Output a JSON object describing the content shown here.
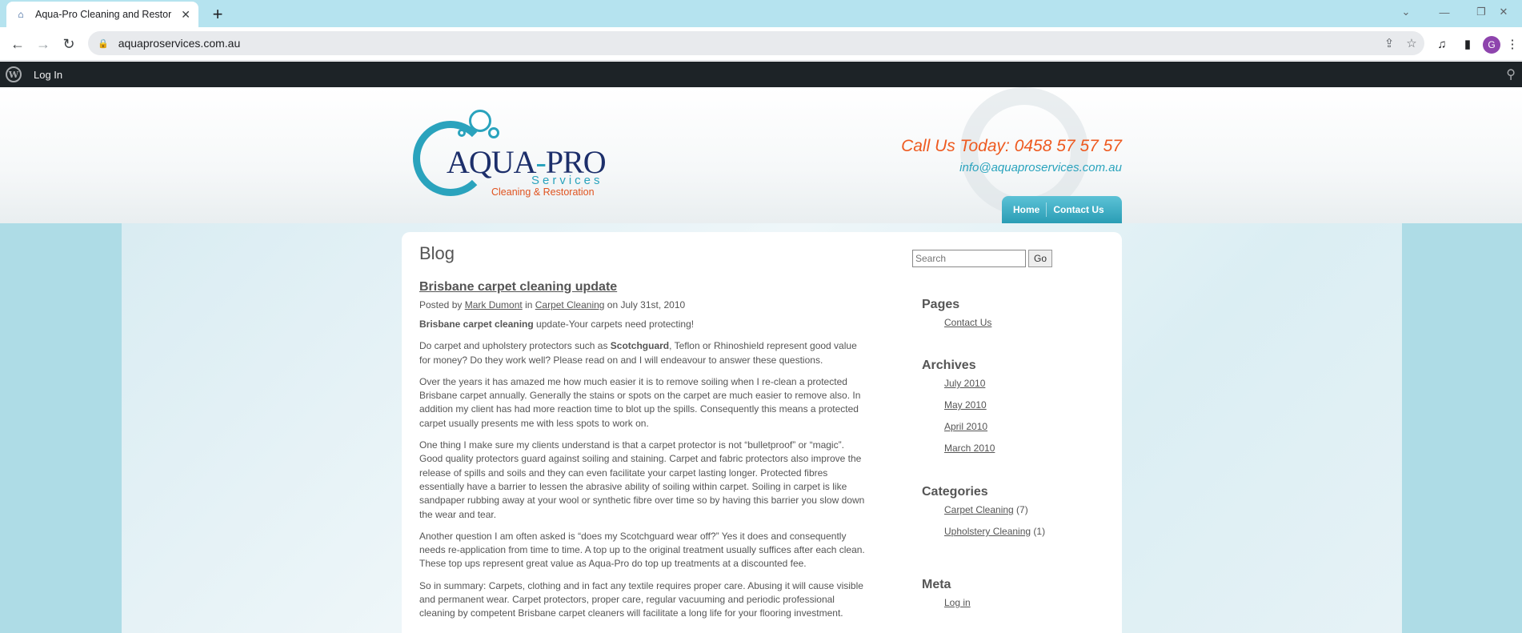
{
  "browser": {
    "tab_title": "Aqua-Pro Cleaning and Restorat",
    "url": "aquaproservices.com.au",
    "profile_initial": "G"
  },
  "admin_bar": {
    "login_label": "Log In"
  },
  "header": {
    "logo_word": "AQUA",
    "logo_word_dash": "-",
    "logo_word_end": "PRO",
    "logo_services": "Services",
    "logo_tagline": "Cleaning & Restoration",
    "call_text": "Call Us Today:  0458 57 57 57",
    "email": "info@aquaproservices.com.au",
    "nav": [
      "Home",
      "Contact Us"
    ]
  },
  "main": {
    "page_title": "Blog",
    "post": {
      "title": "Brisbane carpet cleaning update",
      "meta_prefix": "Posted by ",
      "author": "Mark Dumont",
      "meta_in": " in ",
      "category": "Carpet Cleaning",
      "meta_date": " on July 31st, 2010",
      "intro_bold": "Brisbane carpet cleaning",
      "intro_rest": " update-Your carpets need protecting!",
      "p2_a": "Do carpet and upholstery protectors such as ",
      "p2_bold": "Scotchguard",
      "p2_b": ", Teflon or Rhinoshield represent good value for money? Do they work well? Please read on and I will endeavour to answer these questions.",
      "p3": "Over the years it has amazed me how much easier it is to remove soiling when I re-clean a protected Brisbane carpet annually. Generally the stains or spots on the carpet are much easier to remove also. In addition my client has had more reaction time to blot up the spills. Consequently this means a protected carpet usually presents me with less spots to work on.",
      "p4": "One thing I make sure my clients understand is that a carpet protector is not “bulletproof” or “magic”. Good quality protectors guard against soiling and staining. Carpet and fabric protectors also improve the release of spills and soils and they can even facilitate your carpet lasting longer. Protected fibres essentially have a barrier to lessen the abrasive ability of soiling within carpet. Soiling in carpet is like sandpaper rubbing away at your wool or synthetic fibre over time so by having this barrier you slow down the wear and tear.",
      "p5": "Another question I am often asked is “does my Scotchguard wear off?” Yes it does and consequently needs re-application from time to time. A top up to the original treatment usually suffices after each clean. These top ups represent great value as Aqua-Pro do top up treatments at a discounted fee.",
      "p6": "So in summary: Carpets, clothing and in fact any textile requires proper care. Abusing it will cause visible and permanent wear. Carpet protectors, proper care, regular vacuuming and periodic professional cleaning by competent Brisbane carpet cleaners will facilitate a long life for your flooring investment."
    }
  },
  "sidebar": {
    "search_placeholder": "Search",
    "search_button": "Go",
    "pages_title": "Pages",
    "pages": [
      "Contact Us"
    ],
    "archives_title": "Archives",
    "archives": [
      "July 2010",
      "May 2010",
      "April 2010",
      "March 2010"
    ],
    "categories_title": "Categories",
    "categories": [
      {
        "name": "Carpet Cleaning",
        "count": " (7)"
      },
      {
        "name": "Upholstery Cleaning",
        "count": " (1)"
      }
    ],
    "meta_title": "Meta",
    "meta": [
      "Log in"
    ]
  }
}
